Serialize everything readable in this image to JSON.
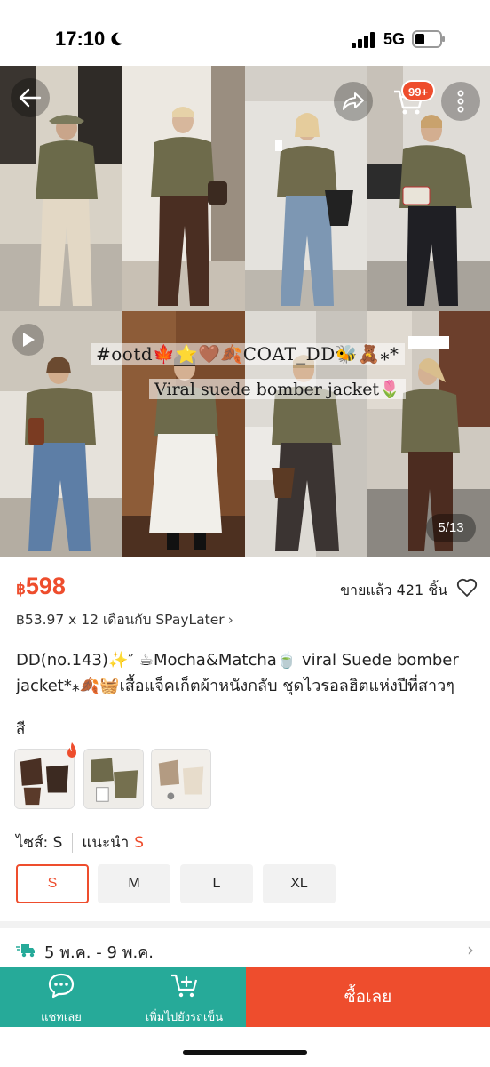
{
  "status_bar": {
    "time": "17:10",
    "network": "5G"
  },
  "gallery": {
    "overlay_line1": "#ootd🍁⭐🤎🍂COAT_DD🐝🧸⁎*",
    "overlay_line2": "Viral suede bomber jacket🌷",
    "cart_badge": "99+",
    "page_counter": "5/13",
    "icons": [
      "back-arrow-icon",
      "share-icon",
      "cart-icon",
      "more-icon",
      "play-icon"
    ]
  },
  "product": {
    "currency": "฿",
    "price": "598",
    "sold": "ขายแล้ว 421 ชิ้น",
    "installment": "฿53.97 x 12 เดือนกับ SPayLater",
    "title": "DD(no.143)✨″ ☕Mocha&Matcha🍵 viral Suede bomber jacket*⁎🍂🧺เสื้อแจ็คเก็ตผ้าหนังกลับ ชุดไวรอลฮิตแห่งปีที่สาวๆ"
  },
  "variation": {
    "color_label": "สี",
    "size_label": "ไซส์: S",
    "recommend_label": "แนะนำ",
    "recommend_value": "S",
    "sizes": [
      "S",
      "M",
      "L",
      "XL"
    ],
    "selected_size": "S"
  },
  "shipping": {
    "date_range": "5 พ.ค. - 9 พ.ค."
  },
  "bottom_bar": {
    "chat_label": "แชทเลย",
    "add_to_cart_label": "เพิ่มไปยังรถเข็น",
    "buy_label": "ซื้อเลย"
  },
  "colors": {
    "accent": "#ee4d2d",
    "teal": "#26aa99"
  }
}
